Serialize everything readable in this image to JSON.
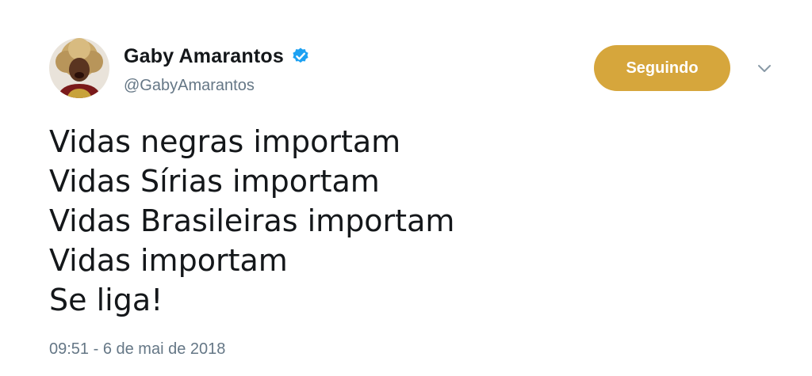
{
  "author": {
    "display_name": "Gaby Amarantos",
    "handle": "@GabyAmarantos",
    "verified_icon": "verified-badge-icon",
    "avatar_icon": "profile-avatar"
  },
  "follow_button": {
    "label": "Seguindo",
    "color": "#d6a63c"
  },
  "menu": {
    "icon": "chevron-down-icon"
  },
  "tweet": {
    "lines": [
      "Vidas negras importam",
      "Vidas Sírias importam",
      "Vidas Brasileiras importam",
      "Vidas importam",
      "Se liga!"
    ],
    "timestamp": "09:51 - 6 de mai de 2018"
  },
  "colors": {
    "verified": "#1da1f2",
    "secondary_text": "#657786",
    "primary_text": "#14171a"
  }
}
